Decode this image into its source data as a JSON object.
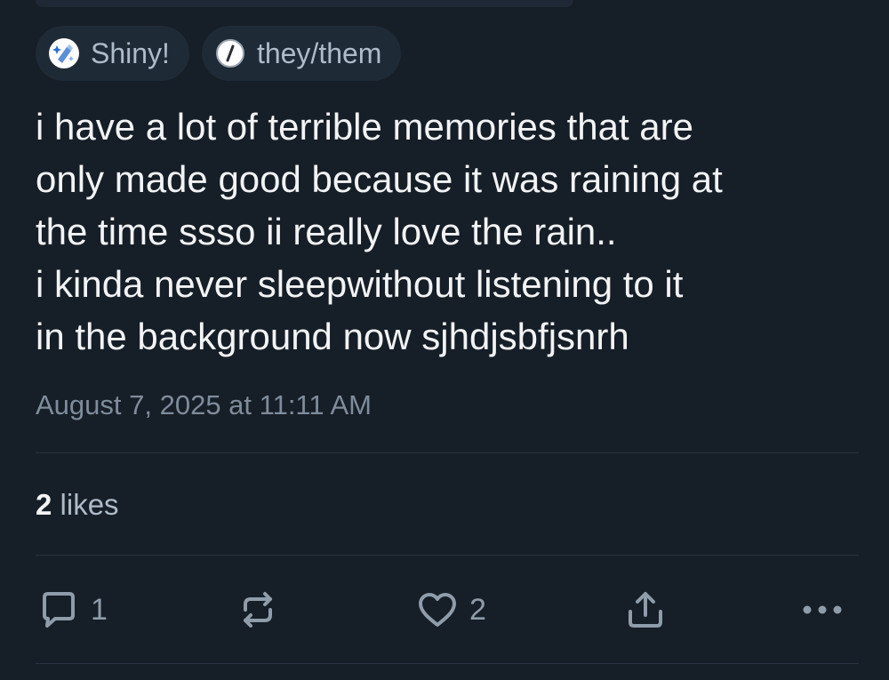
{
  "badges": [
    {
      "label": "Shiny!",
      "icon": "sparkle-chip-icon"
    },
    {
      "label": "they/them",
      "icon": "slash-circle-icon"
    }
  ],
  "post": {
    "text": "i have a lot of terrible memories that are\nonly made good because it was raining at\nthe time ssso ii really love the rain..\ni kinda never sleepwithout listening to it\nin the background now sjhdjsbfjsnrh",
    "timestamp": "August 7, 2025 at 11:11 AM"
  },
  "stats": {
    "likes_count": "2",
    "likes_label": "likes"
  },
  "actions": {
    "reply_count": "1",
    "like_count": "2",
    "icons": [
      "reply-icon",
      "repost-icon",
      "heart-icon",
      "share-icon",
      "more-icon"
    ]
  },
  "colors": {
    "background": "#161e27",
    "badge_background": "#1f2a37",
    "text": "#f1f3f5",
    "muted_text": "#7f8c9b",
    "icon": "#8f9caa",
    "divider": "#2a3541"
  }
}
